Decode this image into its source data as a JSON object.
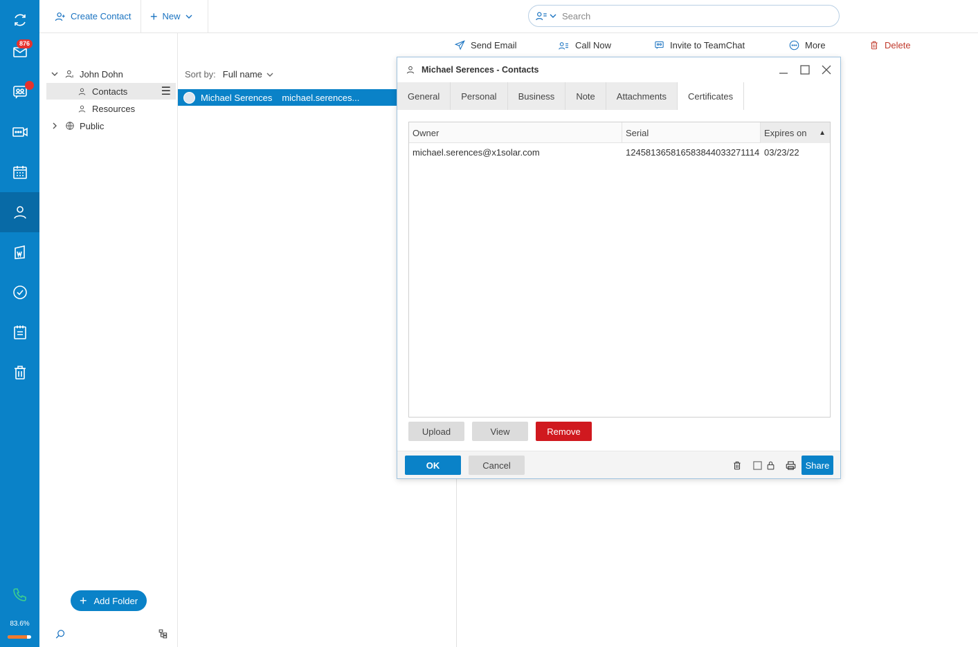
{
  "rail": {
    "mail_badge": "876",
    "usage_label": "83.6%",
    "usage_fraction": 0.836
  },
  "topbar": {
    "create_contact": "Create Contact",
    "new": "New",
    "search_placeholder": "Search"
  },
  "actions": {
    "send_email": "Send Email",
    "call_now": "Call Now",
    "invite_teamchat": "Invite to TeamChat",
    "more": "More",
    "delete": "Delete"
  },
  "tree": {
    "account": "John Dohn",
    "contacts": "Contacts",
    "resources": "Resources",
    "public": "Public",
    "add_folder": "Add Folder"
  },
  "list": {
    "sort_label": "Sort by:",
    "sort_value": "Full name",
    "rows": [
      {
        "name": "Michael Serences",
        "email": "michael.serences..."
      }
    ]
  },
  "dialog": {
    "title": "Michael Serences - Contacts",
    "tabs": [
      "General",
      "Personal",
      "Business",
      "Note",
      "Attachments",
      "Certificates"
    ],
    "active_tab": "Certificates",
    "columns": [
      "Owner",
      "Serial",
      "Expires on"
    ],
    "sort_indicator": "▲",
    "rows": [
      {
        "owner": "michael.serences@x1solar.com",
        "serial": "124581365816583844033271114",
        "expires": "03/23/22"
      }
    ],
    "upload": "Upload",
    "view": "View",
    "remove": "Remove",
    "ok": "OK",
    "cancel": "Cancel",
    "share": "Share"
  },
  "colors": {
    "brand": "#0a82c8",
    "danger": "#d0191f",
    "badge": "#e5322d"
  }
}
